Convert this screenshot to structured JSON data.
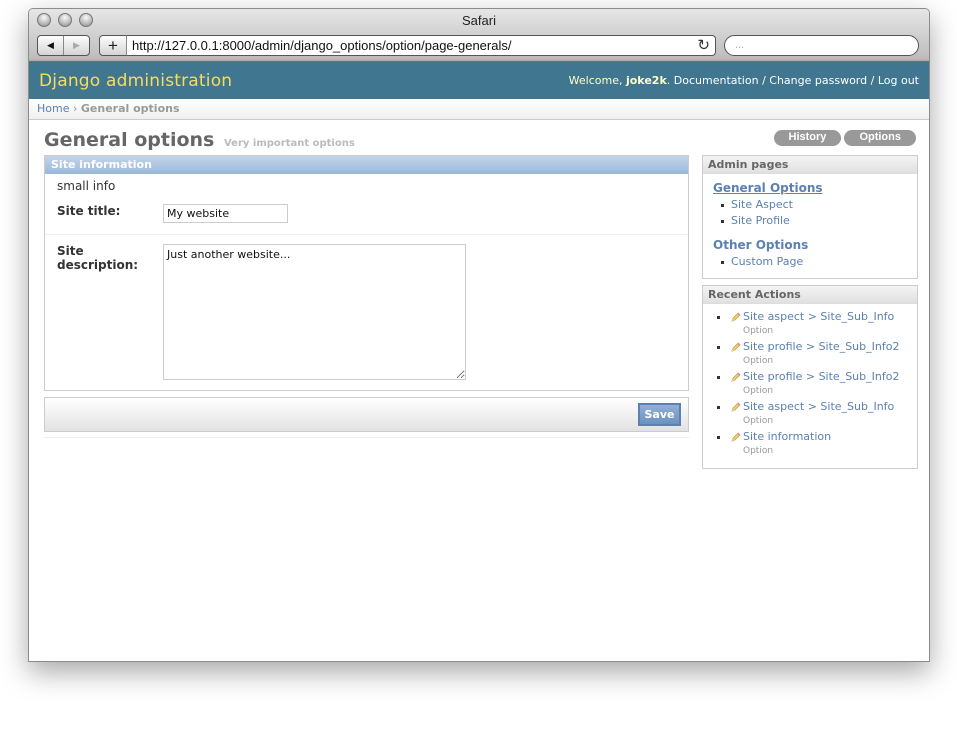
{
  "browser": {
    "title": "Safari",
    "url": "http://127.0.0.1:8000/admin/django_options/option/page-generals/",
    "search_placeholder": "..."
  },
  "header": {
    "branding": "Django administration",
    "welcome": "Welcome,",
    "username": "joke2k",
    "links": [
      "Documentation",
      "Change password",
      "Log out"
    ],
    "separator": " / "
  },
  "breadcrumbs": {
    "home": "Home",
    "separator": " › ",
    "current": "General options"
  },
  "page": {
    "title": "General options",
    "subtitle": "Very important options",
    "object_tools": [
      "History",
      "Options"
    ]
  },
  "fieldset": {
    "title": "Site information",
    "description": "small info",
    "fields": [
      {
        "label": "Site title:",
        "value": "My website"
      },
      {
        "label": "Site description:",
        "value": "Just another website..."
      }
    ],
    "save_label": "Save"
  },
  "sidebar": {
    "admin_pages": {
      "title": "Admin pages",
      "groups": [
        {
          "title": "General Options",
          "active": true,
          "items": [
            "Site Aspect",
            "Site Profile"
          ]
        },
        {
          "title": "Other Options",
          "active": false,
          "items": [
            "Custom Page"
          ]
        }
      ]
    },
    "recent_actions": {
      "title": "Recent Actions",
      "items": [
        {
          "label": "Site aspect > Site_Sub_Info",
          "type": "Option",
          "icon": "pencil-icon"
        },
        {
          "label": "Site profile > Site_Sub_Info2",
          "type": "Option",
          "icon": "pencil-icon"
        },
        {
          "label": "Site profile > Site_Sub_Info2",
          "type": "Option",
          "icon": "pencil-icon"
        },
        {
          "label": "Site aspect > Site_Sub_Info",
          "type": "Option",
          "icon": "pencil-icon"
        },
        {
          "label": "Site information",
          "type": "Option",
          "icon": "pencil-icon"
        }
      ]
    }
  },
  "colors": {
    "header_bg": "#417690",
    "branding": "#f5dd5d",
    "link": "#5b80b2",
    "fieldset_header": "#98b7da"
  }
}
